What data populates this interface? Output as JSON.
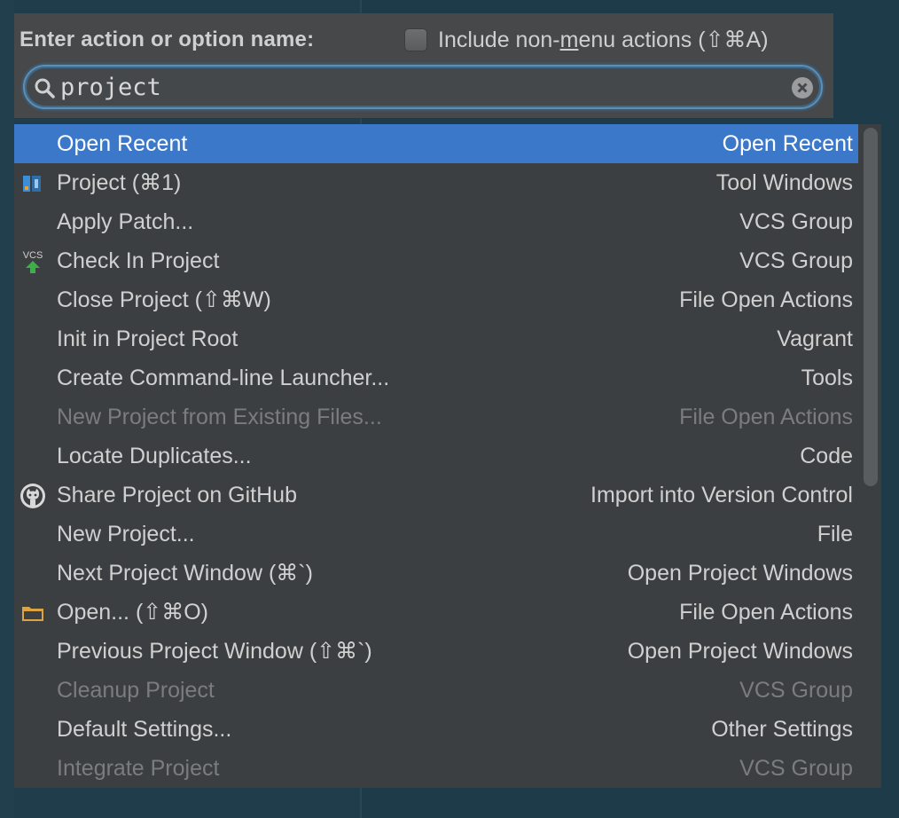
{
  "header": {
    "label": "Enter action or option name:",
    "nonmenu_prefix": "Include non-",
    "nonmenu_underlined": "m",
    "nonmenu_suffix": "enu actions (⇧⌘A)",
    "checkbox_checked": false
  },
  "search": {
    "value": "project",
    "placeholder": ""
  },
  "results": [
    {
      "name": "Open Recent",
      "group": "Open Recent",
      "icon": "",
      "state": "selected"
    },
    {
      "name": "Project (⌘1)",
      "group": "Tool Windows",
      "icon": "project-tool-window-icon",
      "state": "normal"
    },
    {
      "name": "Apply Patch...",
      "group": "VCS Group",
      "icon": "",
      "state": "normal"
    },
    {
      "name": "Check In Project",
      "group": "VCS Group",
      "icon": "vcs-commit-icon",
      "state": "normal"
    },
    {
      "name": "Close Project (⇧⌘W)",
      "group": "File Open Actions",
      "icon": "",
      "state": "normal"
    },
    {
      "name": "Init in Project Root",
      "group": "Vagrant",
      "icon": "",
      "state": "normal"
    },
    {
      "name": "Create Command-line Launcher...",
      "group": "Tools",
      "icon": "",
      "state": "normal"
    },
    {
      "name": "New Project from Existing Files...",
      "group": "File Open Actions",
      "icon": "",
      "state": "disabled"
    },
    {
      "name": "Locate Duplicates...",
      "group": "Code",
      "icon": "",
      "state": "normal"
    },
    {
      "name": "Share Project on GitHub",
      "group": "Import into Version Control",
      "icon": "github-icon",
      "state": "normal"
    },
    {
      "name": "New Project...",
      "group": "File",
      "icon": "",
      "state": "normal"
    },
    {
      "name": "Next Project Window (⌘`)",
      "group": "Open Project Windows",
      "icon": "",
      "state": "normal"
    },
    {
      "name": "Open... (⇧⌘O)",
      "group": "File Open Actions",
      "icon": "folder-icon",
      "state": "normal"
    },
    {
      "name": "Previous Project Window (⇧⌘`)",
      "group": "Open Project Windows",
      "icon": "",
      "state": "normal"
    },
    {
      "name": "Cleanup Project",
      "group": "VCS Group",
      "icon": "",
      "state": "disabled"
    },
    {
      "name": "Default Settings...",
      "group": "Other Settings",
      "icon": "",
      "state": "normal"
    },
    {
      "name": "Integrate Project",
      "group": "VCS Group",
      "icon": "",
      "state": "disabled"
    }
  ],
  "icons": {
    "vcs_label": "VCS"
  },
  "colors": {
    "selection": "#3b78c9",
    "panel": "#3c3f41",
    "header": "#46484a",
    "focus_ring": "#5c8fb5"
  }
}
